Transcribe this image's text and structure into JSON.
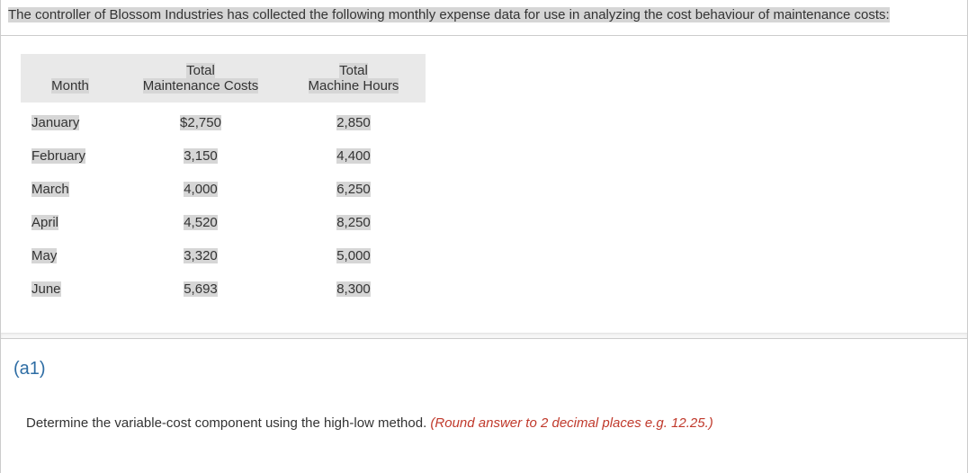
{
  "intro": {
    "line": "The controller of Blossom Industries has collected the following monthly expense data for use in analyzing the cost behaviour of maintenance costs:"
  },
  "table": {
    "headers": {
      "month": "Month",
      "cost_line1": "Total",
      "cost_line2": "Maintenance Costs",
      "hours_line1": "Total",
      "hours_line2": "Machine Hours"
    },
    "rows": [
      {
        "month": "January",
        "cost": "$2,750",
        "hours": "2,850"
      },
      {
        "month": "February",
        "cost": "3,150",
        "hours": "4,400"
      },
      {
        "month": "March",
        "cost": "4,000",
        "hours": "6,250"
      },
      {
        "month": "April",
        "cost": "4,520",
        "hours": "8,250"
      },
      {
        "month": "May",
        "cost": "3,320",
        "hours": "5,000"
      },
      {
        "month": "June",
        "cost": "5,693",
        "hours": "8,300"
      }
    ]
  },
  "part_label": "(a1)",
  "question": {
    "main": "Determine the variable-cost component using the high-low method. ",
    "note": "(Round answer to 2 decimal places e.g. 12.25.)"
  }
}
